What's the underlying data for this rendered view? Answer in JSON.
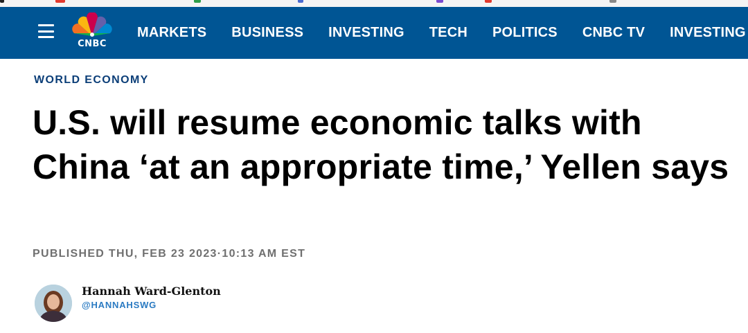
{
  "nav": {
    "logo_text": "CNBC",
    "items": [
      "MARKETS",
      "BUSINESS",
      "INVESTING",
      "TECH",
      "POLITICS",
      "CNBC TV",
      "INVESTING"
    ]
  },
  "article": {
    "kicker": "WORLD ECONOMY",
    "headline": "U.S. will resume economic talks with China ‘at an appropriate time,’ Yellen says",
    "published": "PUBLISHED THU, FEB 23 2023·10:13 AM EST"
  },
  "author": {
    "name": "Hannah Ward-Glenton",
    "handle": "@HANNAHSWG"
  },
  "colors": {
    "nav_bg": "#005594",
    "kicker": "#0b3e78",
    "handle": "#2a7ac2"
  }
}
